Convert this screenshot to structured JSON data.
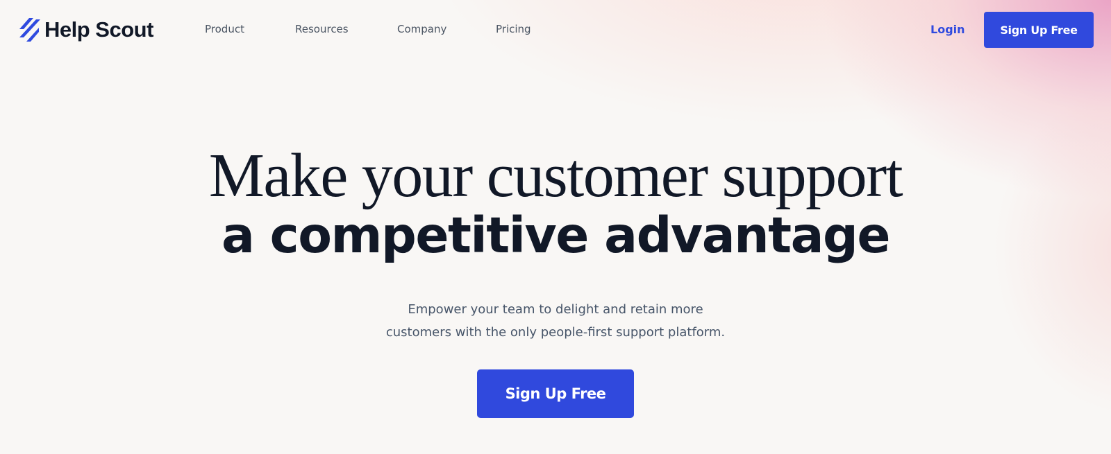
{
  "brand": {
    "name": "Help Scout",
    "icon": "help-scout-stripes-icon",
    "accent_color": "#3049dd"
  },
  "nav": {
    "items": [
      {
        "label": "Product"
      },
      {
        "label": "Resources"
      },
      {
        "label": "Company"
      },
      {
        "label": "Pricing"
      }
    ]
  },
  "header_actions": {
    "login_label": "Login",
    "signup_label": "Sign Up Free"
  },
  "hero": {
    "headline_line1": "Make your customer support",
    "headline_line2": "a competitive advantage",
    "subtext_line1": "Empower your team to delight and retain more",
    "subtext_line2": "customers with the only people-first support platform.",
    "cta_label": "Sign Up Free"
  }
}
